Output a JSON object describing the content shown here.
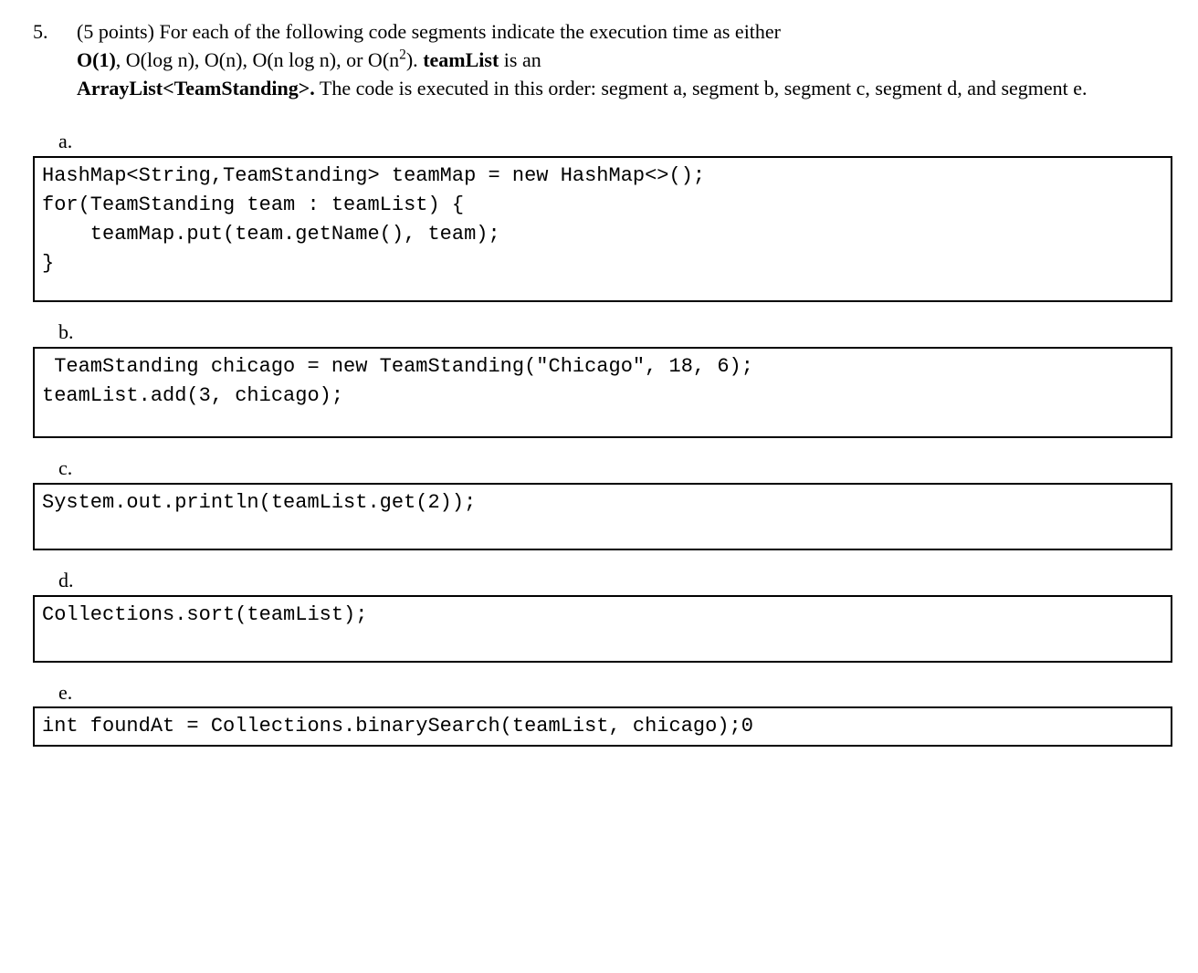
{
  "question": {
    "number": "5.",
    "points_prefix": "(5 points) ",
    "intro_part1": "For each of the following code segments indicate the execution time as either ",
    "options_bold1": "O(1)",
    "options_sep1": ", ",
    "opt2": "O(log n), O(n), O(n log n), or O(n",
    "opt_sup": "2",
    "opt_close": ").  ",
    "teamlist_bold": "teamList",
    "intro_part2": " is an ",
    "arraylist_bold": "ArrayList<TeamStanding>.",
    "intro_part3": " The code is executed in this order: segment a, segment b, segment c, segment d, and segment e."
  },
  "segments": {
    "a": {
      "label": "a.",
      "code": "HashMap<String,TeamStanding> teamMap = new HashMap<>();\nfor(TeamStanding team : teamList) {\n    teamMap.put(team.getName(), team);\n}"
    },
    "b": {
      "label": "b.",
      "code": " TeamStanding chicago = new TeamStanding(\"Chicago\", 18, 6);\nteamList.add(3, chicago);"
    },
    "c": {
      "label": "c.",
      "code": "System.out.println(teamList.get(2));"
    },
    "d": {
      "label": "d.",
      "code": "Collections.sort(teamList);"
    },
    "e": {
      "label": "e.",
      "code": "int foundAt = Collections.binarySearch(teamList, chicago);0"
    }
  }
}
